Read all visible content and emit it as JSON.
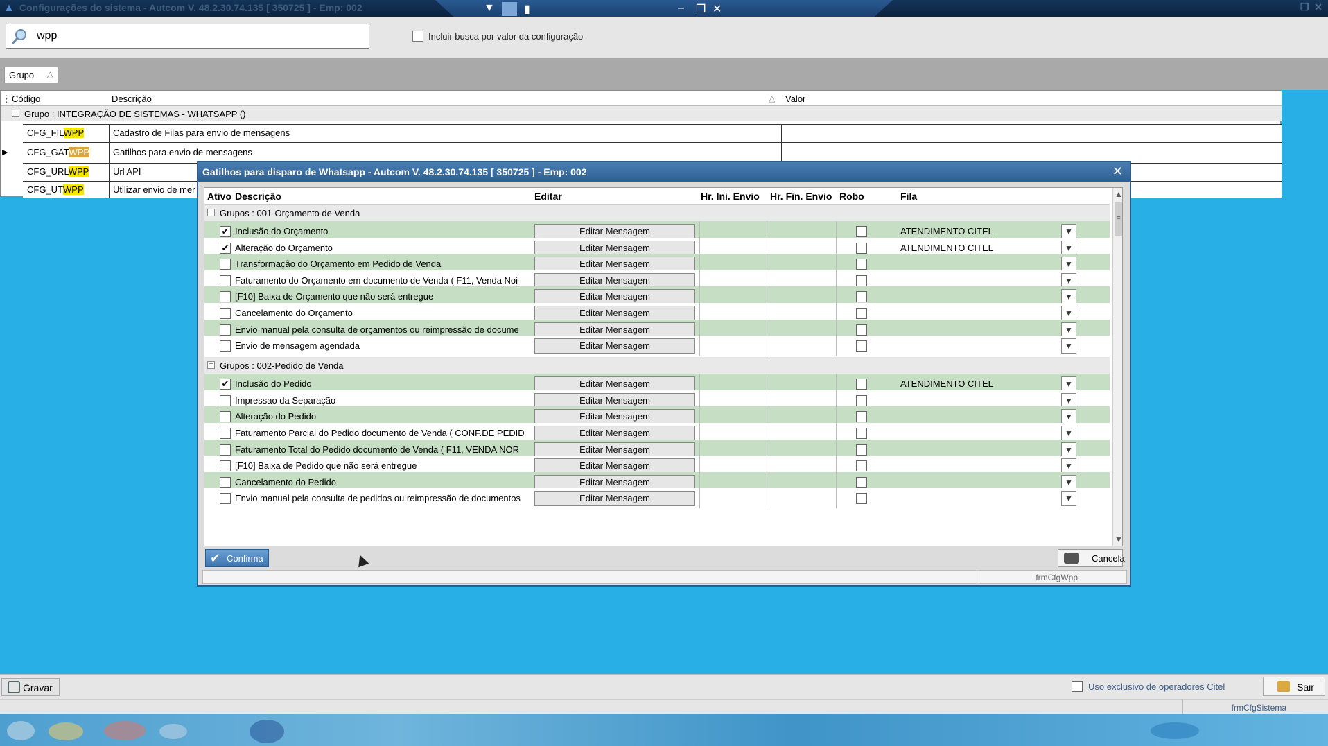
{
  "window": {
    "title": "Configurações do sistema  -  Autcom V. 48.2.30.74.135 [ 350725 ] - Emp: 002"
  },
  "search": {
    "value": "wpp",
    "include_value_label": "Incluir busca por valor da configuração"
  },
  "group_chip": "Grupo",
  "main_grid": {
    "headers": {
      "codigo": "Código",
      "descricao": "Descrição",
      "valor": "Valor"
    },
    "group_label": "Grupo : INTEGRAÇÃO DE SISTEMAS - WHATSAPP ()",
    "rows": [
      {
        "code_prefix": "CFG_FIL",
        "code_hl": "WPP",
        "desc": "Cadastro de Filas para envio de mensagens"
      },
      {
        "code_prefix": "CFG_GAT",
        "code_hl": "WPP",
        "desc": "Gatilhos para envio de mensagens"
      },
      {
        "code_prefix": "CFG_URL",
        "code_hl": "WPP",
        "desc": "Url API"
      },
      {
        "code_prefix": "CFG_UT",
        "code_hl": "WPP",
        "desc": "Utilizar envio de mer"
      }
    ]
  },
  "dialog": {
    "title": "Gatilhos para disparo de Whatsapp   -   Autcom V. 48.2.30.74.135 [ 350725 ] - Emp: 002",
    "headers": {
      "ativo": "Ativo",
      "descricao": "Descrição",
      "editar": "Editar",
      "hr_ini": "Hr. Ini. Envio",
      "hr_fin": "Hr. Fin. Envio",
      "robo": "Robo",
      "fila": "Fila"
    },
    "edit_button_label": "Editar Mensagem",
    "groups": [
      {
        "label": "Grupos : 001-Orçamento de Venda",
        "rows": [
          {
            "checked": "✔",
            "desc": "Inclusão do Orçamento",
            "fila": "ATENDIMENTO CITEL"
          },
          {
            "checked": "✔",
            "desc": "Alteração do Orçamento",
            "fila": "ATENDIMENTO CITEL"
          },
          {
            "checked": "",
            "desc": "Transformação do Orçamento em Pedido de Venda",
            "fila": ""
          },
          {
            "checked": "",
            "desc": "Faturamento do Orçamento em documento de Venda ( F11, Venda Noi",
            "fila": ""
          },
          {
            "checked": "",
            "desc": "[F10] Baixa de Orçamento que não será entregue",
            "fila": ""
          },
          {
            "checked": "",
            "desc": "Cancelamento do Orçamento",
            "fila": ""
          },
          {
            "checked": "",
            "desc": "Envio manual pela consulta de orçamentos ou reimpressão de docume",
            "fila": ""
          },
          {
            "checked": "",
            "desc": "Envio de mensagem agendada",
            "fila": ""
          }
        ]
      },
      {
        "label": "Grupos : 002-Pedido de Venda",
        "rows": [
          {
            "checked": "✔",
            "desc": "Inclusão do Pedido",
            "fila": "ATENDIMENTO CITEL"
          },
          {
            "checked": "",
            "desc": "Impressao da Separação",
            "fila": ""
          },
          {
            "checked": "",
            "desc": "Alteração do Pedido",
            "fila": ""
          },
          {
            "checked": "",
            "desc": "Faturamento Parcial do Pedido documento de Venda ( CONF.DE PEDID",
            "fila": ""
          },
          {
            "checked": "",
            "desc": "Faturamento Total do Pedido documento de Venda ( F11, VENDA NOR",
            "fila": ""
          },
          {
            "checked": "",
            "desc": "[F10] Baixa de Pedido que não será entregue",
            "fila": ""
          },
          {
            "checked": "",
            "desc": "Cancelamento do Pedido",
            "fila": ""
          },
          {
            "checked": "",
            "desc": "Envio manual pela consulta de pedidos ou reimpressão de documentos",
            "fila": ""
          }
        ]
      }
    ],
    "confirm_label": "Confirma",
    "cancel_label": "Cancela",
    "form_name": "frmCfgWpp"
  },
  "bottom": {
    "gravar_label": "Gravar",
    "uso_label": "Uso exclusivo de operadores Citel",
    "sair_label": "Sair",
    "form_name": "frmCfgSistema"
  }
}
